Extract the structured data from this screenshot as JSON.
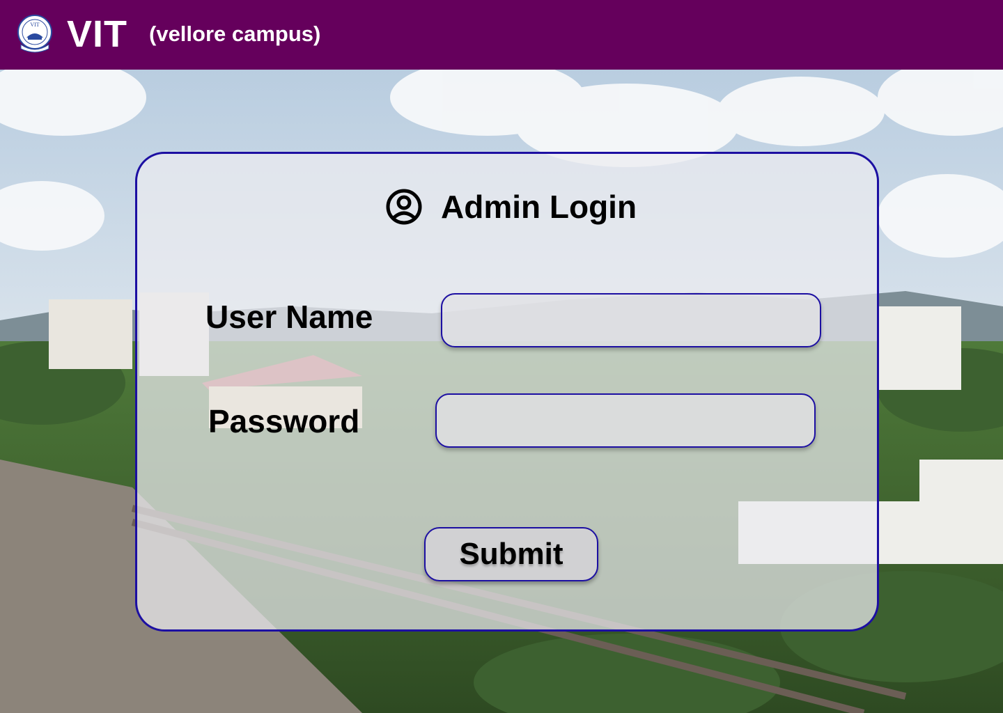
{
  "header": {
    "brand": "VIT",
    "campus": "(vellore campus)",
    "logo_text": "VIT"
  },
  "login": {
    "title": "Admin Login",
    "icon": "user-circle-icon",
    "username_label": "User Name",
    "username_value": "",
    "password_label": "Password",
    "password_value": "",
    "submit_label": "Submit"
  },
  "colors": {
    "header_bg": "#65005c",
    "accent_border": "#1c0fa2",
    "card_bg": "rgba(236,236,240,0.72)",
    "button_bg": "#d1d1d3"
  }
}
